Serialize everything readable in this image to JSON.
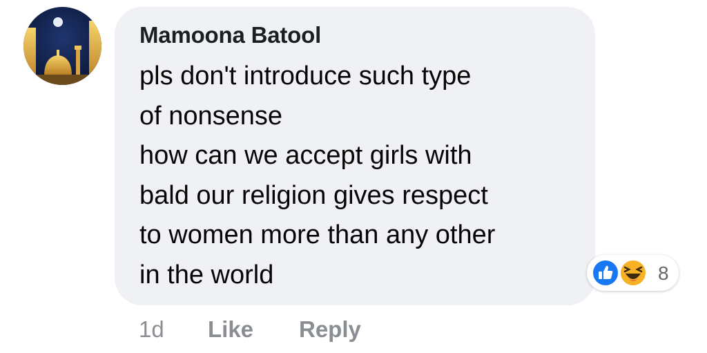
{
  "comment": {
    "author": "Mamoona Batool",
    "text": "pls don't introduce such type\nof nonsense\nhow can we accept girls with\nbald our religion gives respect\nto women more than any other\nin the world",
    "avatar_icon": "avatar-photo",
    "reactions": {
      "icons": [
        "like-icon",
        "haha-icon"
      ],
      "count": "8",
      "colors": {
        "like": "#1877f2",
        "haha": "#f7b125"
      }
    },
    "actions": {
      "timestamp": "1d",
      "like_label": "Like",
      "reply_label": "Reply"
    }
  },
  "colors": {
    "bubble": "#eff1f5",
    "meta_text": "#8a8d91"
  }
}
